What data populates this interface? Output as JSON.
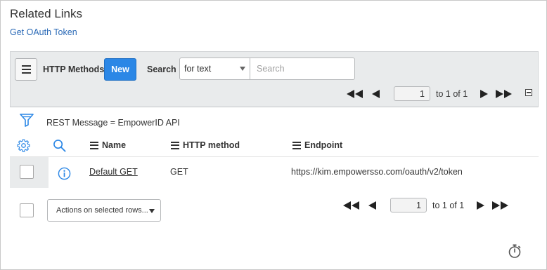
{
  "related": {
    "title": "Related Links",
    "link": "Get OAuth Token"
  },
  "toolbar": {
    "list_title": "HTTP Methods",
    "new_label": "New",
    "search_label": "Search",
    "search_field_value": "for text",
    "search_placeholder": "Search",
    "pager": {
      "page": "1",
      "range_text": "to 1 of 1"
    }
  },
  "filter": {
    "breadcrumb": "REST Message = EmpowerID API"
  },
  "table": {
    "columns": [
      "Name",
      "HTTP method",
      "Endpoint"
    ],
    "rows": [
      {
        "name": "Default GET",
        "method": "GET",
        "endpoint": "https://kim.empowersso.com/oauth/v2/token"
      }
    ]
  },
  "footer": {
    "actions_label": "Actions on selected rows...",
    "pager": {
      "page": "1",
      "range_text": "to 1 of 1"
    }
  },
  "icons": {
    "menu": "hamburger-icon",
    "filter": "funnel-icon",
    "settings": "gear-icon",
    "column_search": "search-icon",
    "info": "info-icon",
    "timer": "stopwatch-icon"
  },
  "colors": {
    "accent": "#2b87e6",
    "link": "#2c6bb7",
    "toolbar_bg": "#e9ebec"
  }
}
